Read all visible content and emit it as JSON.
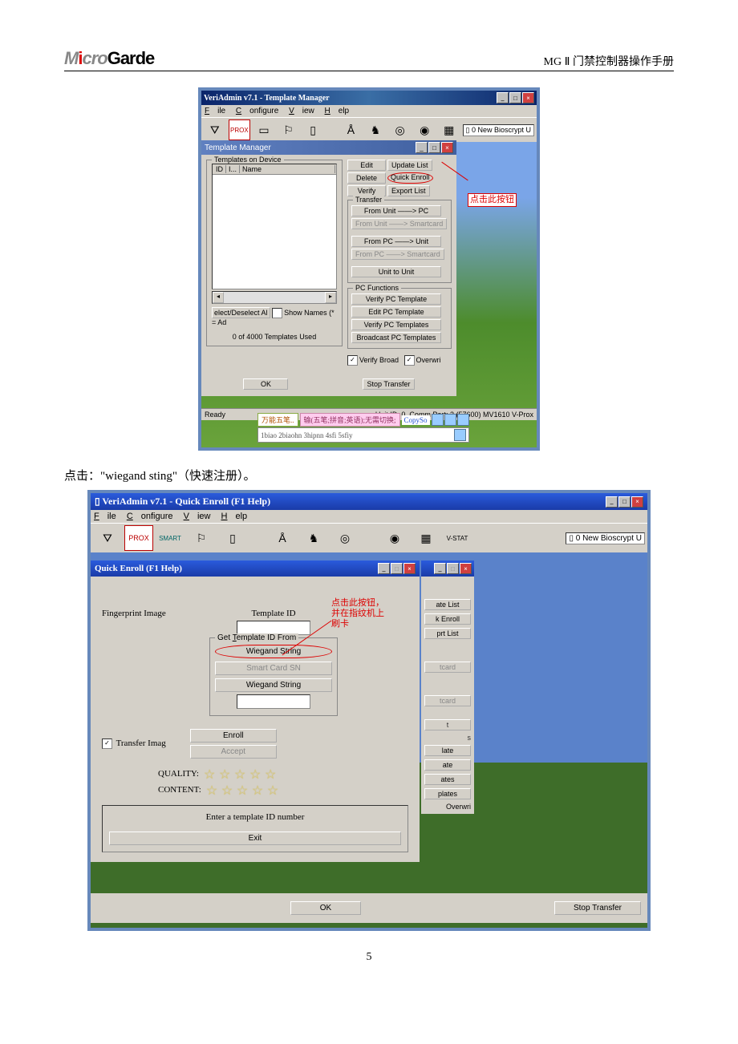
{
  "header": {
    "logo_m": "M",
    "logo_i": "i",
    "logo_cro": "cro",
    "logo_garde": "Garde",
    "doc_title": "MG Ⅱ 门禁控制器操作手册"
  },
  "fig1": {
    "main_title": "VeriAdmin v7.1 - Template Manager",
    "menu": {
      "file": "File",
      "configure": "Configure",
      "view": "View",
      "help": "Help"
    },
    "toolbar_prox": "PROX",
    "toolbar_status": "0 New Bioscrypt U",
    "tm_title": "Template Manager",
    "templates_on_device": "Templates on Device",
    "col_id": "ID",
    "col_i": "I...",
    "col_name": "Name",
    "select_deselect": "elect/Deselect Al",
    "show_names": "Show Names (* = Ad",
    "used": "0 of 4000 Templates Used",
    "btns": {
      "edit": "Edit",
      "update_list": "Update List",
      "delete": "Delete",
      "quick_enroll": "Quick Enroll",
      "verify": "Verify",
      "export_list": "Export List"
    },
    "transfer_legend": "Transfer",
    "transfer": {
      "unit_pc": "From Unit ——> PC",
      "unit_smart": "From Unit ——> Smartcard",
      "pc_unit": "From PC   ——> Unit",
      "pc_smart": "From PC   ——> Smartcard",
      "unit_unit": "Unit to Unit"
    },
    "pcfn_legend": "PC Functions",
    "pcfn": {
      "verify_tpl": "Verify PC Template",
      "edit_tpl": "Edit PC Template",
      "verify_tpls": "Verify PC Templates",
      "broadcast": "Broadcast PC Templates"
    },
    "verify_broad": "Verify Broad",
    "overwri": "Overwri",
    "ok": "OK",
    "stop": "Stop Transfer",
    "status_ready": "Ready",
    "status_info": "Unit ID: 0, Comm Port: 3 (57600)  MV1610 V-Prox",
    "anno": "点击此按钮",
    "ime": {
      "a": "万能五笔..",
      "b": "输(五笔;拼音;英语);无需切换;",
      "c": "CopySo",
      "d": "1biao 2biaohn 3hipnn 4sfi 5sfiy"
    }
  },
  "caption1": "点击：\"wiegand sting\"（快速注册）。",
  "fig2": {
    "main_title": "VeriAdmin v7.1 - Quick Enroll (F1 Help)",
    "menu": {
      "file": "File",
      "configure": "Configure",
      "view": "View",
      "help": "Help"
    },
    "toolbar_prox": "PROX",
    "toolbar_smart": "SMART",
    "toolbar_status": "0 New Bioscrypt U",
    "qe_title": "Quick Enroll (F1 Help)",
    "fingerprint": "Fingerprint Image",
    "template_id": "Template ID",
    "get_id_legend": "Get Template ID From",
    "wiegand1": "Wiegand String",
    "smartcard": "Smart Card SN",
    "wiegand2": "Wiegand String",
    "transfer_img": "Transfer Imag",
    "enroll": "Enroll",
    "accept": "Accept",
    "quality": "QUALITY:",
    "content": "CONTENT:",
    "prompt": "Enter a template ID number",
    "exit": "Exit",
    "ok": "OK",
    "stop": "Stop Transfer",
    "anno": "点击此按钮，\n并在指纹机上\n刷卡",
    "right": {
      "ate_list": "ate List",
      "k_enroll": "k Enroll",
      "prt_list": "prt List",
      "tcard1": "tcard",
      "tcard2": "tcard",
      "t": "t",
      "s": "s",
      "late": "late",
      "ate": "ate",
      "ates": "ates",
      "plates": "plates",
      "overwri": "Overwri"
    }
  },
  "page_number": "5"
}
